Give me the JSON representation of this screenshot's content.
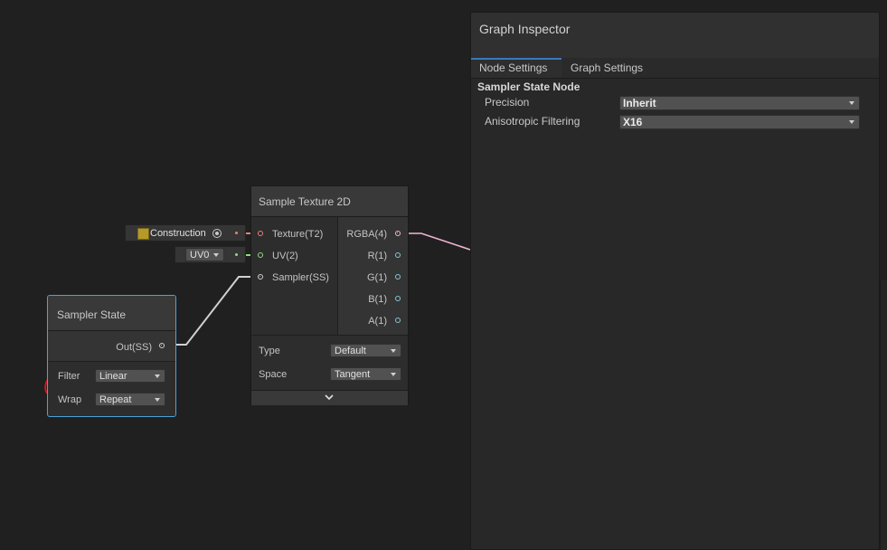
{
  "inspector": {
    "title": "Graph Inspector",
    "tabs": [
      {
        "label": "Node Settings",
        "active": true
      },
      {
        "label": "Graph Settings",
        "active": false
      }
    ],
    "section_title": "Sampler State Node",
    "fields": [
      {
        "label": "Precision",
        "value": "Inherit"
      },
      {
        "label": "Anisotropic Filtering",
        "value": "X16"
      }
    ]
  },
  "sample_texture_node": {
    "title": "Sample Texture 2D",
    "inputs": [
      "Texture(T2)",
      "UV(2)",
      "Sampler(SS)"
    ],
    "outputs": [
      "RGBA(4)",
      "R(1)",
      "G(1)",
      "B(1)",
      "A(1)"
    ],
    "settings": [
      {
        "label": "Type",
        "value": "Default"
      },
      {
        "label": "Space",
        "value": "Tangent"
      }
    ]
  },
  "texture_input": {
    "label": "Construction"
  },
  "uv_input": {
    "value": "UV0"
  },
  "sampler_state_node": {
    "title": "Sampler State",
    "output": "Out(SS)",
    "settings": [
      {
        "label": "Filter",
        "value": "Linear"
      },
      {
        "label": "Wrap",
        "value": "Repeat"
      }
    ]
  },
  "colors": {
    "texture_port": "#e8827a",
    "vector2_port": "#8fdc7c",
    "sampler_port": "#d0d0d0",
    "vector4_port": "#f2b6d6",
    "float_port": "#83c8d8",
    "selection_border": "#4aa3d8",
    "annotation_red": "#d0151e",
    "tab_accent": "#3a79bb"
  }
}
